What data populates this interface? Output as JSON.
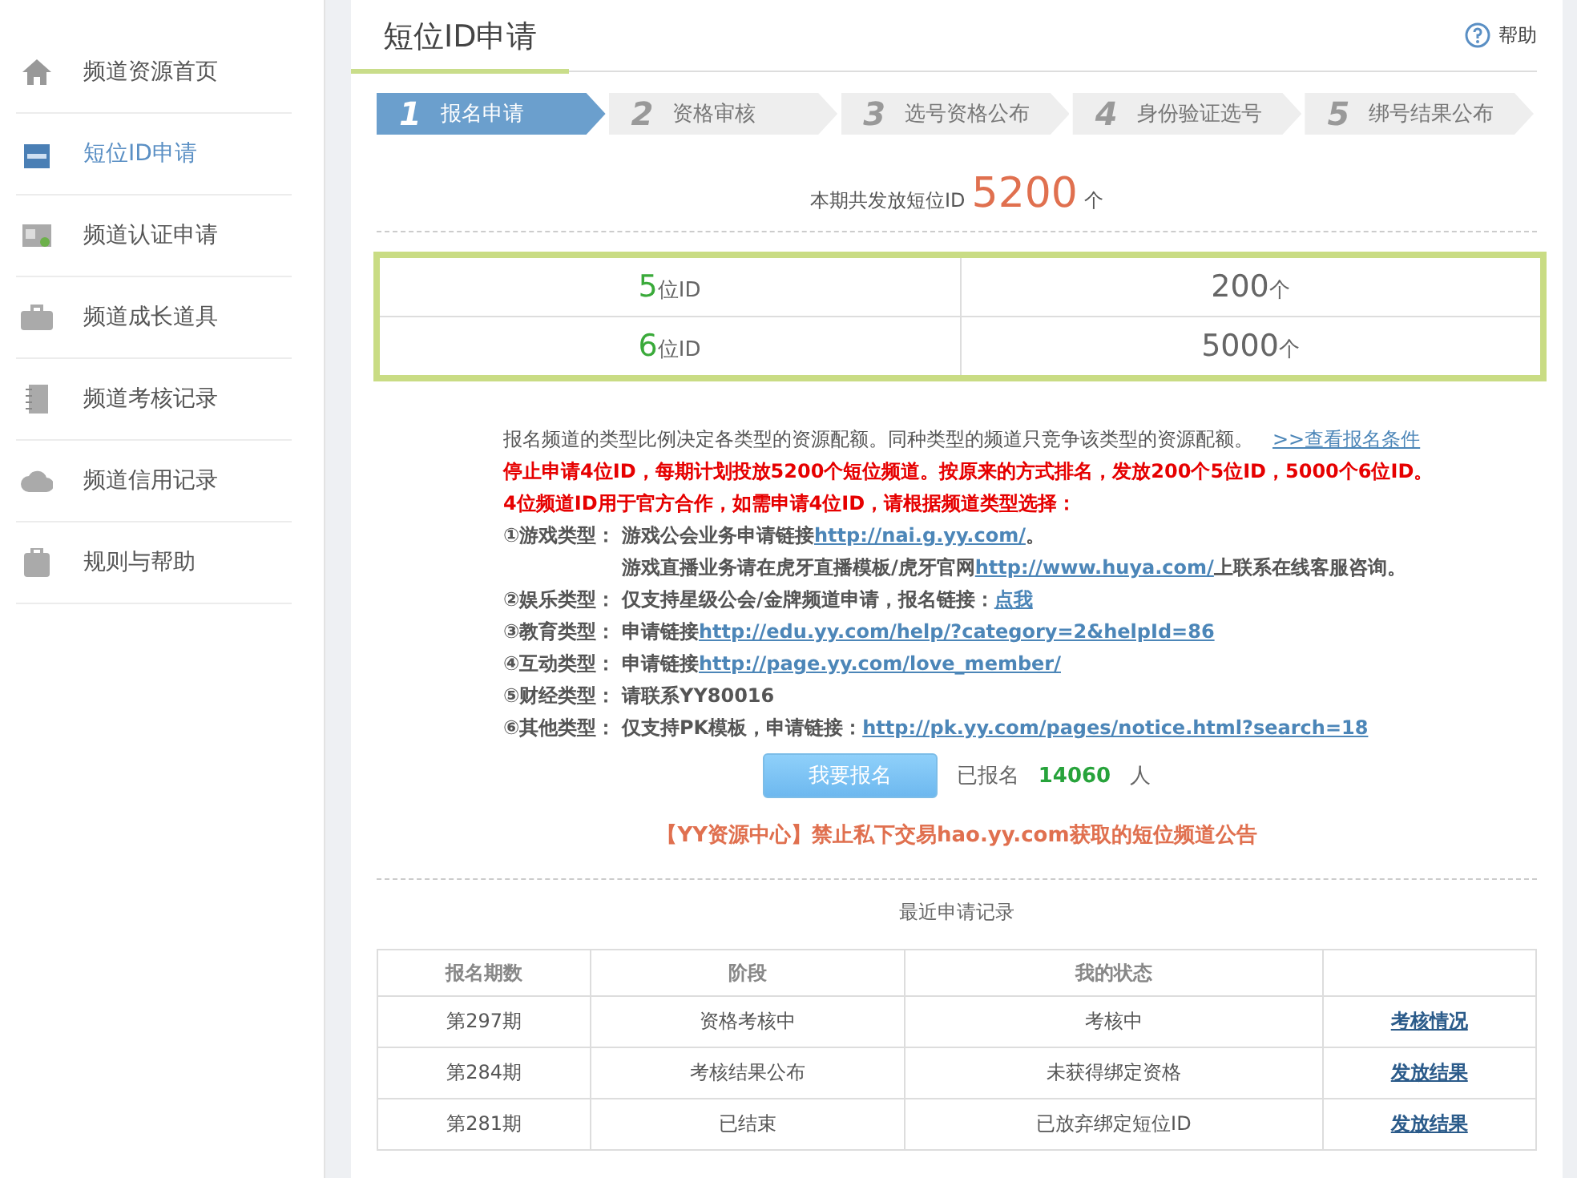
{
  "sidebar": {
    "items": [
      {
        "label": "频道资源首页",
        "selected": false
      },
      {
        "label": "短位ID申请",
        "selected": true
      },
      {
        "label": "频道认证申请",
        "selected": false
      },
      {
        "label": "频道成长道具",
        "selected": false
      },
      {
        "label": "频道考核记录",
        "selected": false
      },
      {
        "label": "频道信用记录",
        "selected": false
      },
      {
        "label": "规则与帮助",
        "selected": false
      }
    ]
  },
  "header": {
    "title": "短位ID申请",
    "help": "帮助"
  },
  "steps": [
    {
      "number": "1",
      "label": "报名申请",
      "selected": true
    },
    {
      "number": "2",
      "label": "资格审核",
      "selected": false
    },
    {
      "number": "3",
      "label": "选号资格公布",
      "selected": false
    },
    {
      "number": "4",
      "label": "身份验证选号",
      "selected": false
    },
    {
      "number": "5",
      "label": "绑号结果公布",
      "selected": false
    }
  ],
  "total": {
    "prefix": "本期共发放短位ID",
    "value": "5200",
    "unit": "个"
  },
  "quota": [
    {
      "digits": "5",
      "digits_unit": "位ID",
      "count": "200",
      "count_unit": "个"
    },
    {
      "digits": "6",
      "digits_unit": "位ID",
      "count": "5000",
      "count_unit": "个"
    }
  ],
  "notice": {
    "intro": "报名频道的类型比例决定各类型的资源配额。同种类型的频道只竞争该类型的资源配额。",
    "intro_link": ">>查看报名条件",
    "warnings": [
      "停止申请4位ID，每期计划投放5200个短位频道。按原来的方式排名，发放200个5位ID，5000个6位ID。",
      "4位频道ID用于官方合作，如需申请4位ID，请根据频道类型选择："
    ],
    "types": [
      {
        "label": "①游戏类型：",
        "lines": [
          [
            {
              "kind": "text",
              "text": "游戏公会业务申请链接"
            },
            {
              "kind": "link",
              "text": "http://nai.g.yy.com/"
            },
            {
              "kind": "text",
              "text": "。"
            }
          ],
          [
            {
              "kind": "text",
              "text": "游戏直播业务请在虎牙直播模板/虎牙官网"
            },
            {
              "kind": "link",
              "text": "http://www.huya.com/"
            },
            {
              "kind": "text",
              "text": "上联系在线客服咨询。"
            }
          ]
        ]
      },
      {
        "label": "②娱乐类型：",
        "lines": [
          [
            {
              "kind": "text",
              "text": "仅支持星级公会/金牌频道申请，报名链接："
            },
            {
              "kind": "link",
              "text": "点我"
            }
          ]
        ]
      },
      {
        "label": "③教育类型：",
        "lines": [
          [
            {
              "kind": "text",
              "text": "申请链接"
            },
            {
              "kind": "link",
              "text": "http://edu.yy.com/help/?category=2&helpId=86"
            }
          ]
        ]
      },
      {
        "label": "④互动类型：",
        "lines": [
          [
            {
              "kind": "text",
              "text": "申请链接"
            },
            {
              "kind": "link",
              "text": "http://page.yy.com/love_member/"
            }
          ]
        ]
      },
      {
        "label": "⑤财经类型：",
        "lines": [
          [
            {
              "kind": "text",
              "text": "请联系YY80016"
            }
          ]
        ]
      },
      {
        "label": "⑥其他类型：",
        "lines": [
          [
            {
              "kind": "text",
              "text": "仅支持PK模板，申请链接："
            },
            {
              "kind": "link",
              "text": "http://pk.yy.com/pages/notice.html?search=18"
            }
          ]
        ]
      }
    ]
  },
  "signup": {
    "button": "我要报名",
    "prefix": "已报名",
    "count": "14060",
    "suffix": "人"
  },
  "announcement": "【YY资源中心】禁止私下交易hao.yy.com获取的短位频道公告",
  "records": {
    "title": "最近申请记录",
    "columns": [
      "报名期数",
      "阶段",
      "我的状态"
    ],
    "rows": [
      {
        "period": "第297期",
        "stage": "资格考核中",
        "status": "考核中",
        "action": "考核情况"
      },
      {
        "period": "第284期",
        "stage": "考核结果公布",
        "status": "未获得绑定资格",
        "action": "发放结果"
      },
      {
        "period": "第281期",
        "stage": "已结束",
        "status": "已放弃绑定短位ID",
        "action": "发放结果"
      }
    ]
  }
}
